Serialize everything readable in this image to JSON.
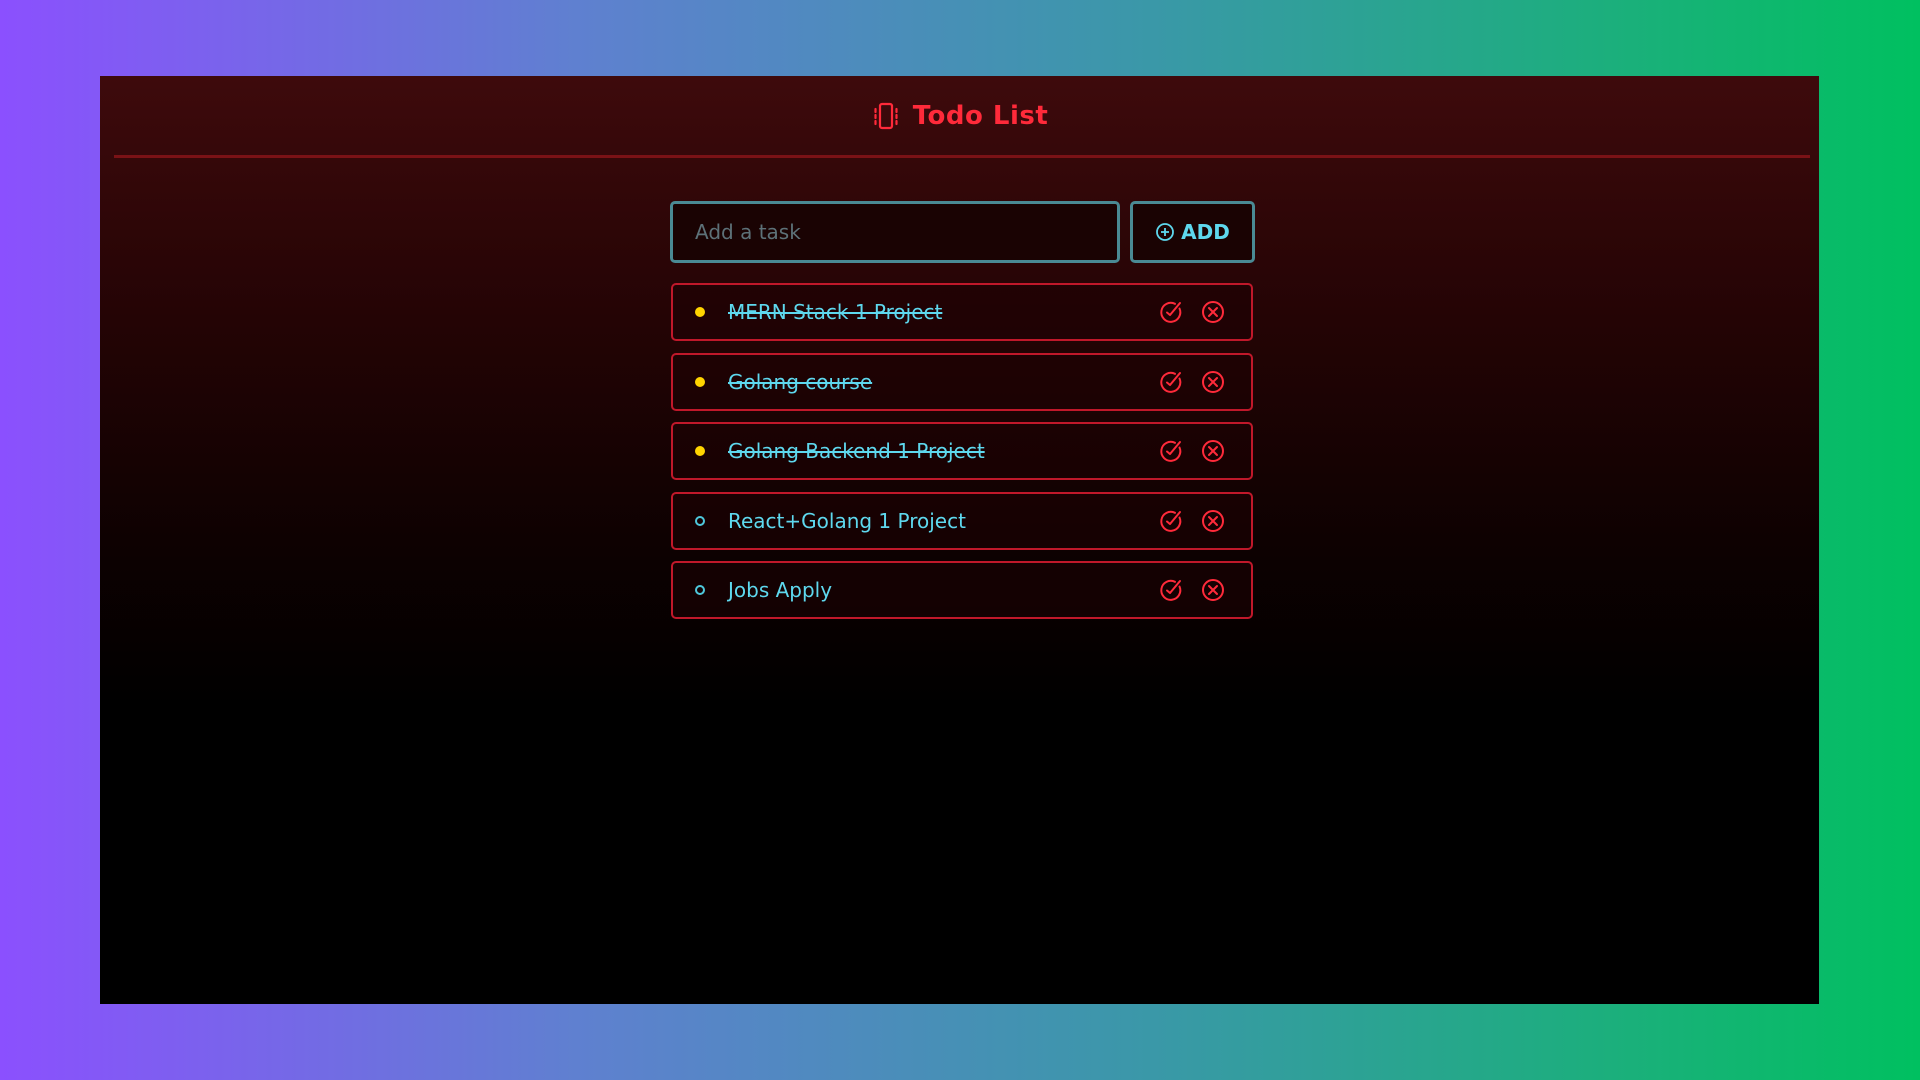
{
  "colors": {
    "accent": "#ff2a3a",
    "border_red": "#c0182a",
    "text_cyan": "#5ed8ee",
    "done_dot": "#ffd400",
    "input_border": "#4a8a94"
  },
  "header": {
    "icon": "phone-vibrate-icon",
    "title": "Todo List"
  },
  "add_form": {
    "placeholder": "Add a task",
    "value": "",
    "button_icon": "plus-circle-icon",
    "button_label": "ADD"
  },
  "tasks": [
    {
      "text": "MERN Stack 1 Project",
      "completed": true,
      "complete_icon": "check-circle-icon",
      "delete_icon": "x-circle-icon"
    },
    {
      "text": "Golang course",
      "completed": true,
      "complete_icon": "check-circle-icon",
      "delete_icon": "x-circle-icon"
    },
    {
      "text": "Golang Backend 1 Project",
      "completed": true,
      "complete_icon": "check-circle-icon",
      "delete_icon": "x-circle-icon"
    },
    {
      "text": "React+Golang 1 Project",
      "completed": false,
      "complete_icon": "check-circle-icon",
      "delete_icon": "x-circle-icon"
    },
    {
      "text": "Jobs Apply",
      "completed": false,
      "complete_icon": "check-circle-icon",
      "delete_icon": "x-circle-icon"
    }
  ]
}
